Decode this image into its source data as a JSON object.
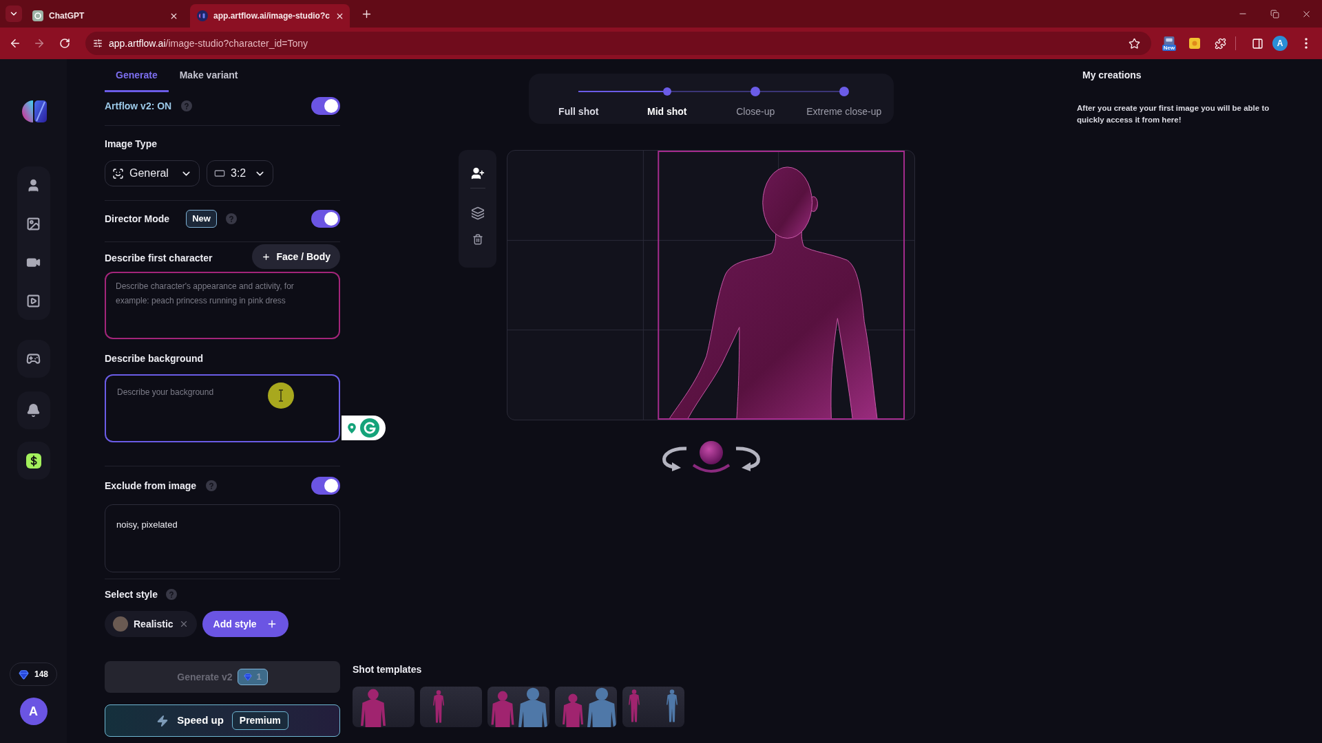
{
  "browser": {
    "tabs": [
      {
        "title": "ChatGPT",
        "selected": false
      },
      {
        "title": "app.artflow.ai/image-studio?c",
        "selected": true
      }
    ],
    "url_host": "app.artflow.ai",
    "url_path": "/image-studio?character_id=Tony",
    "extension_badge": "New",
    "profile_initial": "A"
  },
  "sidebar": {
    "credits": "148",
    "avatar_initial": "A"
  },
  "panel": {
    "tabs": [
      {
        "label": "Generate",
        "selected": true
      },
      {
        "label": "Make variant",
        "selected": false
      }
    ],
    "version": {
      "label": "Artflow v2: ON",
      "on": true
    },
    "image_type": {
      "title": "Image Type",
      "type_value": "General",
      "ratio_value": "3:2"
    },
    "director_mode": {
      "label": "Director Mode",
      "badge": "New",
      "on": true
    },
    "character": {
      "title": "Describe first character",
      "add_button": "Face / Body",
      "placeholder": "Describe character's appearance and activity, for example: peach princess running in pink dress"
    },
    "background": {
      "title": "Describe background",
      "placeholder": "Describe your background"
    },
    "exclude": {
      "title": "Exclude from image",
      "on": true,
      "value": "noisy, pixelated"
    },
    "style": {
      "title": "Select style",
      "chips": [
        {
          "label": "Realistic"
        }
      ],
      "add_button": "Add style"
    },
    "generate": {
      "label": "Generate v2",
      "cost": "1",
      "disabled": true
    },
    "speed_up": {
      "label": "Speed up",
      "badge": "Premium"
    }
  },
  "shot_steps": [
    {
      "label": "Full shot",
      "selected": false
    },
    {
      "label": "Mid shot",
      "selected": true
    },
    {
      "label": "Close-up",
      "selected": false
    },
    {
      "label": "Extreme close-up",
      "selected": false
    }
  ],
  "shot_templates": {
    "title": "Shot templates",
    "items": [
      {
        "kind": "single_mid"
      },
      {
        "kind": "single_full"
      },
      {
        "kind": "duo_mid"
      },
      {
        "kind": "duo_close"
      },
      {
        "kind": "duo_full"
      }
    ]
  },
  "creations": {
    "title": "My creations",
    "empty_text": "After you create your first image you will be able to quickly access it from here!"
  }
}
